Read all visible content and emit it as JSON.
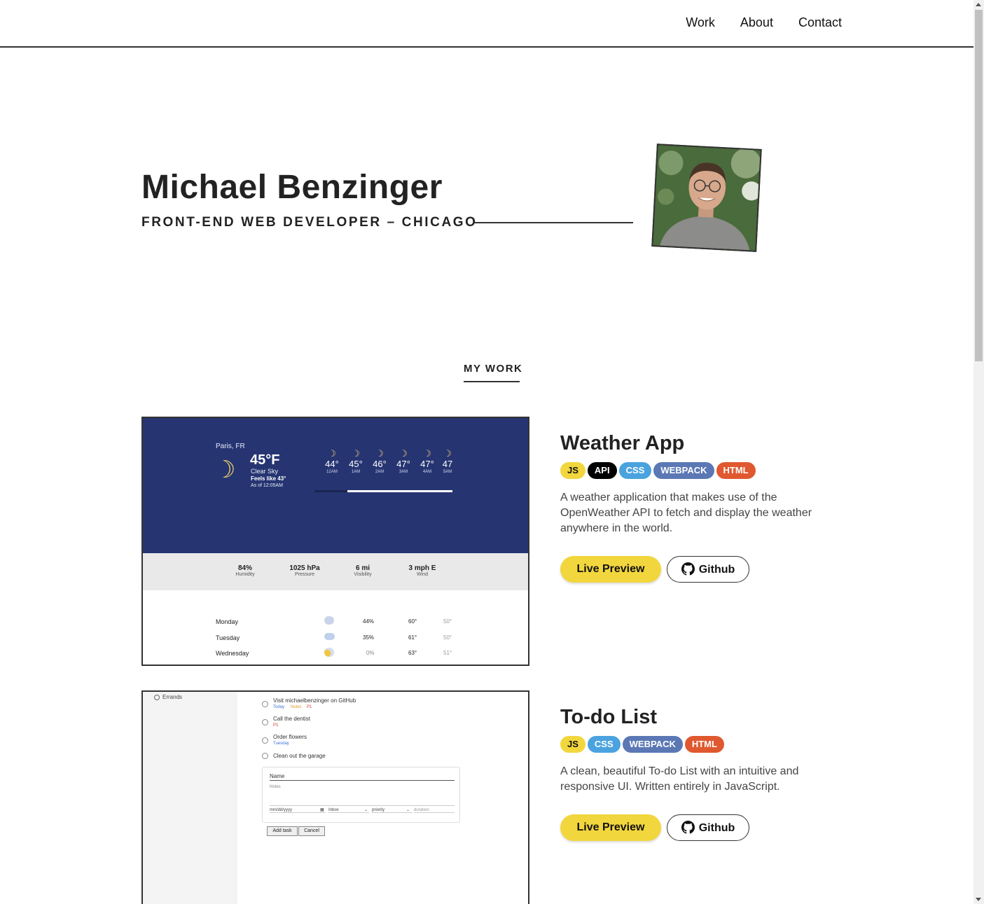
{
  "nav": {
    "items": [
      {
        "label": "Work"
      },
      {
        "label": "About"
      },
      {
        "label": "Contact"
      }
    ]
  },
  "hero": {
    "name": "Michael Benzinger",
    "subtitle": "FRONT-END WEB DEVELOPER – CHICAGO"
  },
  "work": {
    "heading": "MY WORK",
    "projects": [
      {
        "title": "Weather App",
        "tags": [
          "JS",
          "API",
          "CSS",
          "WEBPACK",
          "HTML"
        ],
        "description": "A weather application that makes use of the OpenWeather API to fetch and display the weather anywhere in the world.",
        "live_label": "Live Preview",
        "github_label": "Github"
      },
      {
        "title": "To-do List",
        "tags": [
          "JS",
          "CSS",
          "WEBPACK",
          "HTML"
        ],
        "description": "A clean, beautiful To-do List with an intuitive and responsive UI. Written entirely in JavaScript.",
        "live_label": "Live Preview",
        "github_label": "Github"
      }
    ]
  },
  "tag_colors": {
    "JS": "#f2d63d",
    "API": "#000000",
    "CSS": "#4aa3df",
    "WEBPACK": "#5b78b5",
    "HTML": "#e0582f"
  },
  "weather_screenshot": {
    "location": "Paris, FR",
    "temp": "45°F",
    "condition": "Clear Sky",
    "feels_like": "Feels like 43°",
    "as_of": "As of 12:05AM",
    "hourly": [
      {
        "temp": "44°",
        "time": "12AM"
      },
      {
        "temp": "45°",
        "time": "1AM"
      },
      {
        "temp": "46°",
        "time": "2AM"
      },
      {
        "temp": "47°",
        "time": "3AM"
      },
      {
        "temp": "47°",
        "time": "4AM"
      },
      {
        "temp": "47",
        "time": "5AM"
      }
    ],
    "stats": [
      {
        "value": "84%",
        "label": "Humidity"
      },
      {
        "value": "1025 hPa",
        "label": "Pressure"
      },
      {
        "value": "6 mi",
        "label": "Visibility"
      },
      {
        "value": "3 mph E",
        "label": "Wind"
      }
    ],
    "daily": [
      {
        "day": "Monday",
        "precip": "44%",
        "high": "60°",
        "low": "50°"
      },
      {
        "day": "Tuesday",
        "precip": "35%",
        "high": "61°",
        "low": "50°"
      },
      {
        "day": "Wednesday",
        "precip": "0%",
        "high": "63°",
        "low": "51°"
      }
    ]
  },
  "todo_screenshot": {
    "sidebar_item": "Errands",
    "tasks": [
      {
        "name": "Visit michaelbenzinger on GitHub",
        "meta": [
          "Today",
          "Notes",
          "P1"
        ]
      },
      {
        "name": "Call the dentist",
        "meta": [
          "P1"
        ]
      },
      {
        "name": "Order flowers",
        "meta": [
          "Tuesday"
        ]
      },
      {
        "name": "Clean out the garage",
        "meta": []
      }
    ],
    "form": {
      "name_placeholder": "Name",
      "notes_placeholder": "Notes",
      "date_placeholder": "mm/dd/yyyy",
      "project_value": "Inbox",
      "priority_value": "priority",
      "duration_placeholder": "duration",
      "add_label": "Add task",
      "cancel_label": "Cancel"
    }
  }
}
